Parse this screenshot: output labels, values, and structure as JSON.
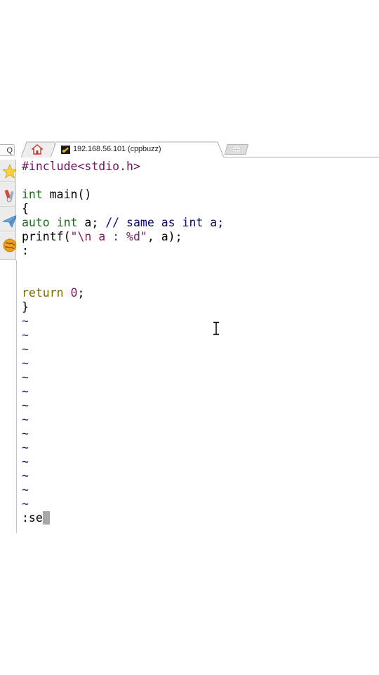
{
  "search": {
    "label": "Q"
  },
  "tabs": {
    "home_tab": {
      "icon": "home-icon"
    },
    "session_tab": {
      "title": "192.168.56.101 (cppbuzz)",
      "icon": "terminal-session-icon"
    },
    "new_tab": {
      "icon": "plus-icon"
    }
  },
  "launch_bar": {
    "items": [
      {
        "icon": "star-icon"
      },
      {
        "icon": "tools-icon"
      },
      {
        "icon": "paper-plane-icon"
      },
      {
        "icon": "globe-icon"
      }
    ]
  },
  "editor": {
    "lines": [
      {
        "kind": "preproc",
        "text": "#include<stdio.h>"
      },
      {
        "kind": "blank",
        "text": ""
      },
      {
        "kind": "main",
        "type": "int",
        "rest": " main()"
      },
      {
        "kind": "plain",
        "text": "{"
      },
      {
        "kind": "decl",
        "t1": "auto",
        "t2": "int",
        "t3": " a; ",
        "comment": "// same as int a;"
      },
      {
        "kind": "printf",
        "p1": "printf(",
        "str": "\"\\n a : %d\"",
        "p2": ", a);"
      },
      {
        "kind": "plain",
        "text": ":"
      },
      {
        "kind": "blank",
        "text": ""
      },
      {
        "kind": "blank",
        "text": ""
      },
      {
        "kind": "return",
        "kw": "return",
        "sp": " ",
        "num": "0",
        "semi": ";"
      },
      {
        "kind": "plain",
        "text": "}"
      }
    ],
    "empty_line_marker": "~",
    "empty_line_count": 14,
    "command_line": ":se"
  },
  "colors": {
    "preprocessor": "#6e145e",
    "type": "#1a6b1a",
    "statement": "#7a6a00",
    "string": "#7a1f65",
    "comment": "#0a0a78",
    "tilde": "#1b1b80",
    "cursor": "#a8a8a8"
  }
}
